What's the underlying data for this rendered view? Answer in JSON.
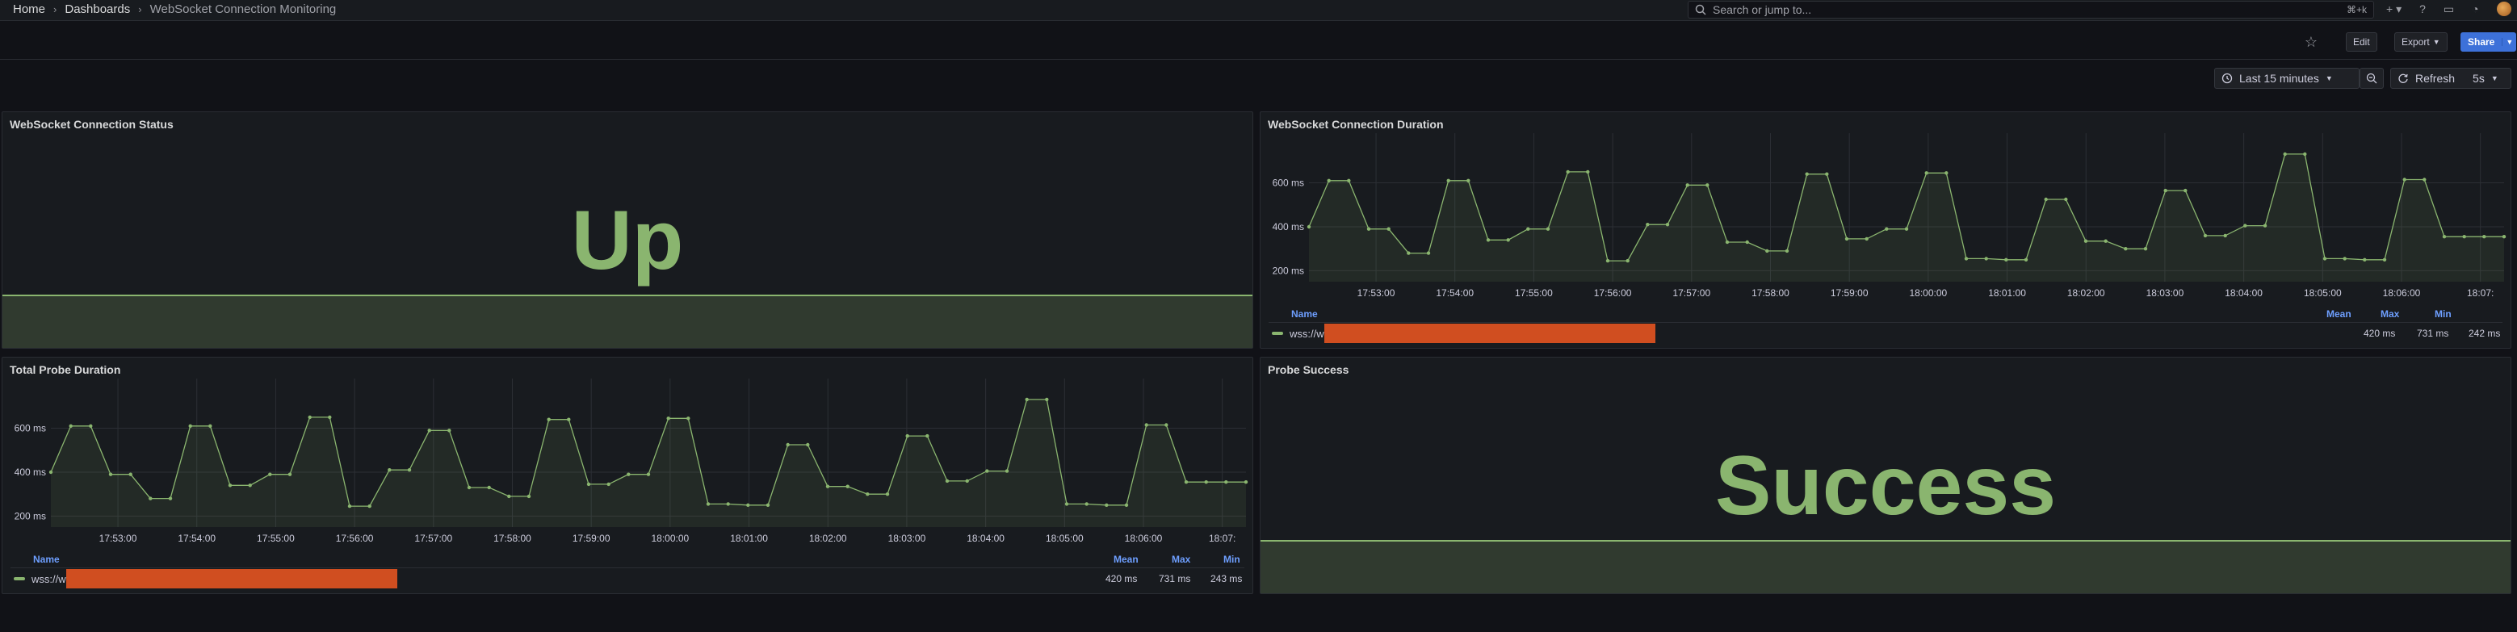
{
  "breadcrumb": {
    "home": "Home",
    "dashboards": "Dashboards",
    "current": "WebSocket Connection Monitoring"
  },
  "search": {
    "placeholder": "Search or jump to...",
    "shortcut": "⌘+k"
  },
  "toolbar": {
    "edit": "Edit",
    "export": "Export",
    "share": "Share"
  },
  "timepicker": {
    "range": "Last 15 minutes",
    "refresh": "Refresh",
    "interval": "5s"
  },
  "panels": {
    "status": {
      "title": "WebSocket Connection Status",
      "value": "Up"
    },
    "duration": {
      "title": "WebSocket Connection Duration",
      "legend": {
        "name_header": "Name",
        "mean_header": "Mean",
        "max_header": "Max",
        "min_header": "Min",
        "series": "wss://w",
        "mean": "420 ms",
        "max": "731 ms",
        "min": "242 ms"
      }
    },
    "probe": {
      "title": "Total Probe Duration",
      "legend": {
        "name_header": "Name",
        "mean_header": "Mean",
        "max_header": "Max",
        "min_header": "Min",
        "series": "wss://w",
        "mean": "420 ms",
        "max": "731 ms",
        "min": "243 ms"
      }
    },
    "success": {
      "title": "Probe Success",
      "value": "Success"
    }
  },
  "colors": {
    "series": "#8ab56f",
    "accent": "#6e9fff",
    "share": "#3d71d9",
    "redaction": "#d04e20"
  },
  "chart_data": [
    {
      "type": "line",
      "title": "WebSocket Connection Duration",
      "yticks": [
        "200 ms",
        "400 ms",
        "600 ms"
      ],
      "ylim": [
        150,
        760
      ],
      "xticks": [
        "17:53:00",
        "17:54:00",
        "17:55:00",
        "17:56:00",
        "17:57:00",
        "17:58:00",
        "17:59:00",
        "18:00:00",
        "18:01:00",
        "18:02:00",
        "18:03:00",
        "18:04:00",
        "18:05:00",
        "18:06:00",
        "18:07:"
      ],
      "series": [
        {
          "name": "wss://w",
          "values": [
            400,
            610,
            610,
            390,
            390,
            280,
            280,
            610,
            610,
            340,
            340,
            390,
            390,
            650,
            650,
            245,
            245,
            410,
            410,
            590,
            590,
            330,
            330,
            290,
            290,
            640,
            640,
            345,
            345,
            390,
            390,
            645,
            645,
            255,
            255,
            250,
            250,
            525,
            525,
            335,
            335,
            300,
            300,
            565,
            565,
            360,
            360,
            405,
            405,
            731,
            731,
            255,
            255,
            250,
            250,
            615,
            615,
            355,
            355,
            355,
            355
          ]
        }
      ]
    },
    {
      "type": "line",
      "title": "Total Probe Duration",
      "yticks": [
        "200 ms",
        "400 ms",
        "600 ms"
      ],
      "ylim": [
        150,
        760
      ],
      "xticks": [
        "17:53:00",
        "17:54:00",
        "17:55:00",
        "17:56:00",
        "17:57:00",
        "17:58:00",
        "17:59:00",
        "18:00:00",
        "18:01:00",
        "18:02:00",
        "18:03:00",
        "18:04:00",
        "18:05:00",
        "18:06:00",
        "18:07:"
      ],
      "series": [
        {
          "name": "wss://w",
          "values": [
            400,
            610,
            610,
            390,
            390,
            280,
            280,
            610,
            610,
            340,
            340,
            390,
            390,
            650,
            650,
            245,
            245,
            410,
            410,
            590,
            590,
            330,
            330,
            290,
            290,
            640,
            640,
            345,
            345,
            390,
            390,
            645,
            645,
            255,
            255,
            250,
            250,
            525,
            525,
            335,
            335,
            300,
            300,
            565,
            565,
            360,
            360,
            405,
            405,
            731,
            731,
            255,
            255,
            250,
            250,
            615,
            615,
            355,
            355,
            355,
            355
          ]
        }
      ]
    }
  ]
}
